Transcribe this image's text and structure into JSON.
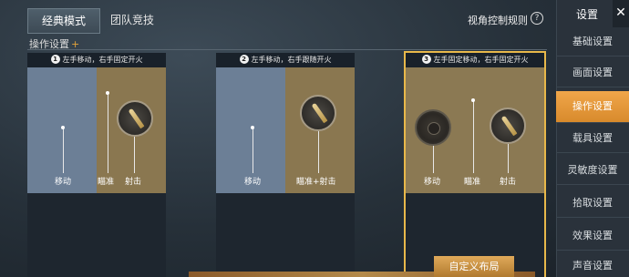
{
  "tabs": [
    {
      "label": "经典模式",
      "active": true
    },
    {
      "label": "团队竞技",
      "active": false
    }
  ],
  "header": {
    "view_control_rules": "视角控制规则",
    "help_glyph": "?",
    "section_title": "操作设置",
    "section_plus": "+"
  },
  "cards": [
    {
      "number": "1",
      "title": "左手移动，右手固定开火",
      "labels": {
        "move": "移动",
        "aim": "瞄准",
        "shoot": "射击"
      },
      "selected": false
    },
    {
      "number": "2",
      "title": "左手移动，右手跟随开火",
      "labels": {
        "move": "移动",
        "aim_shoot": "瞄准+射击"
      },
      "selected": false
    },
    {
      "number": "3",
      "title": "左手固定移动，右手固定开火",
      "labels": {
        "move": "移动",
        "aim": "瞄准",
        "shoot": "射击"
      },
      "selected": true
    }
  ],
  "custom_layout_button": "自定义布局",
  "sidebar": {
    "title": "设置",
    "close_glyph": "✕",
    "items": [
      {
        "label": "基础设置",
        "active": false
      },
      {
        "label": "画面设置",
        "active": false
      },
      {
        "label": "操作设置",
        "active": true
      },
      {
        "label": "载具设置",
        "active": false
      },
      {
        "label": "灵敏度设置",
        "active": false
      },
      {
        "label": "拾取设置",
        "active": false
      },
      {
        "label": "效果设置",
        "active": false
      },
      {
        "label": "声音设置",
        "active": false
      }
    ]
  },
  "colors": {
    "accent": "#e8b84a",
    "sidebar_active": "#e89a3a",
    "move_pane": "#6c7f96",
    "aim_pane": "#8a7750"
  }
}
